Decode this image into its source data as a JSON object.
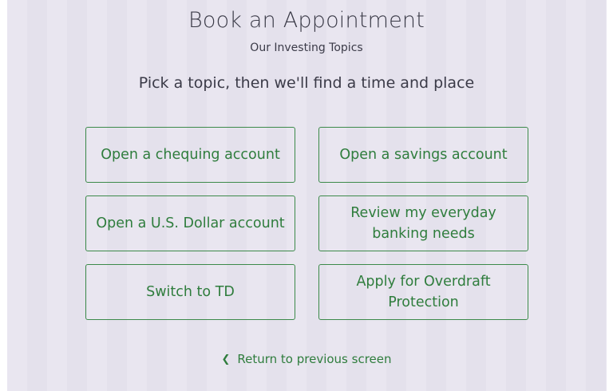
{
  "header": {
    "title": "Book an Appointment",
    "subtitle": "Our Investing Topics"
  },
  "prompt": "Pick a topic, then we'll find a time and place",
  "topics": [
    {
      "label": "Open a chequing account"
    },
    {
      "label": "Open a savings account"
    },
    {
      "label": "Open a U.S. Dollar account"
    },
    {
      "label": "Review my everyday banking needs"
    },
    {
      "label": "Switch to TD"
    },
    {
      "label": "Apply for Overdraft Protection"
    }
  ],
  "back": {
    "icon": "chevron-left-icon",
    "label": "Return to previous screen"
  },
  "colors": {
    "accent": "#2f7d3d",
    "background": "#e9e6f0",
    "text": "#3b3b48"
  }
}
